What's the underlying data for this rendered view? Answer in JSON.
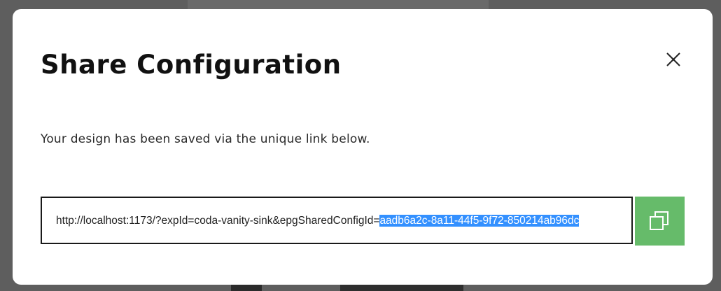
{
  "modal": {
    "title": "Share Configuration",
    "description": "Your design has been saved via the unique link below.",
    "link": {
      "prefix": "http://localhost:1173/?expId=coda-vanity-sink&epgSharedConfigId=",
      "selected": "aadb6a2c-8a11-44f5-9f72-850214ab96dc"
    },
    "close_icon": "close-icon",
    "copy_icon": "copy-icon"
  },
  "colors": {
    "copy_button": "#66bb6a",
    "selection": "#3390ff",
    "border": "#1a1a1a"
  }
}
